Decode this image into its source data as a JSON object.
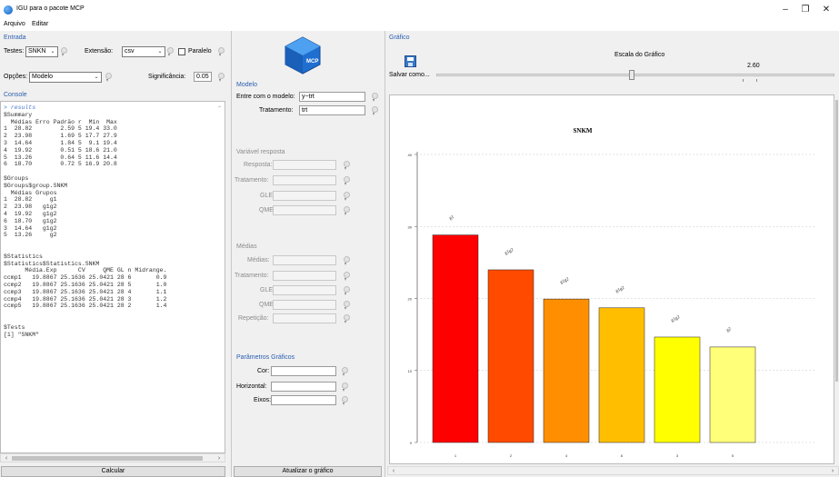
{
  "window": {
    "title": "IGU para o pacote MCP",
    "minimize": "–",
    "maximize": "❐",
    "close": "✕"
  },
  "menu": [
    "Arquivo",
    "Editar"
  ],
  "entrada": {
    "title": "Entrada",
    "testes_label": "Testes:",
    "testes_value": "SNKN",
    "extensao_label": "Extensão:",
    "extensao_value": "csv",
    "paralelo_label": "Paralelo",
    "opcoes_label": "Opções:",
    "opcoes_value": "Modelo",
    "significancia_label": "Significância:",
    "significancia_value": "0.05"
  },
  "console": {
    "title": "Console",
    "text": "> results\n$Summary\n  Médias Erro Padrão r  Min  Max\n1  28.82        2.59 5 19.4 33.0\n2  23.98        1.69 5 17.7 27.9\n3  14.64        1.84 5  9.1 19.4\n4  19.92        0.51 5 18.6 21.0\n5  13.26        0.64 5 11.6 14.4\n6  18.70        0.72 5 16.9 20.8\n\n$Groups\n$Groups$group.SNKM\n  Médias Grupos\n1  28.82     g1\n2  23.98   g1g2\n4  19.92   g1g2\n6  18.70   g1g2\n3  14.64   g1g2\n5  13.26     g2\n\n\n$Statistics\n$Statistics$Statistics.SNKM\n      Média.Exp      CV     QME GL n Midrange.\nccmp1   19.8867 25.1636 25.0421 28 6       0.9\nccmp2   19.8867 25.1636 25.0421 28 5       1.0\nccmp3   19.8867 25.1636 25.0421 28 4       1.1\nccmp4   19.8867 25.1636 25.0421 28 3       1.2\nccmp5   19.8867 25.1636 25.0421 28 2       1.4\n\n\n$Tests\n[1] \"SNKM\"",
    "calcular_label": "Calcular"
  },
  "modelo": {
    "logo_text": "MCP",
    "title": "Modelo",
    "entre_label": "Entre com o modelo:",
    "entre_value": "y~trt",
    "tratamento_label": "Tratamento:",
    "tratamento_value": "trt"
  },
  "variavel": {
    "title": "Variável resposta",
    "resposta_label": "Resposta:",
    "tratamento_label": "Tratamento:",
    "gle_label": "GLE",
    "qme_label": "QME"
  },
  "medias": {
    "title": "Médias",
    "medias_label": "Médias:",
    "tratamento_label": "Tratamento:",
    "gle_label": "GLE",
    "qme_label": "QME",
    "repeticao_label": "Repetição:"
  },
  "parametros": {
    "title": "Parâmetros Gráficos",
    "cor_label": "Cor:",
    "horizontal_label": "Horizontal:",
    "eixos_label": "Eixos:",
    "atualizar_label": "Atualizar o gráfico"
  },
  "grafico": {
    "title": "Gráfico",
    "salvar_label": "Salvar como...",
    "escala_label": "Escala do Gráfico",
    "escala_value": "2.60",
    "escala_fraction": 0.49
  },
  "chart_data": {
    "type": "bar",
    "title": "SNKM",
    "categories": [
      "1",
      "2",
      "4",
      "6",
      "3",
      "5"
    ],
    "values": [
      28.82,
      23.98,
      19.92,
      18.7,
      14.64,
      13.26
    ],
    "bar_labels": [
      "g1",
      "g1g2",
      "g1g2",
      "g1g2",
      "g1g2",
      "g2"
    ],
    "colors": [
      "#ff0000",
      "#ff4a00",
      "#ff8f00",
      "#ffbf00",
      "#ffff00",
      "#ffff7a"
    ],
    "ytick_labels": [
      "0",
      "10",
      "20",
      "30",
      "40"
    ],
    "yticks": [
      0,
      10,
      20,
      30,
      40
    ],
    "ylim": [
      0,
      40
    ],
    "grid": true
  }
}
